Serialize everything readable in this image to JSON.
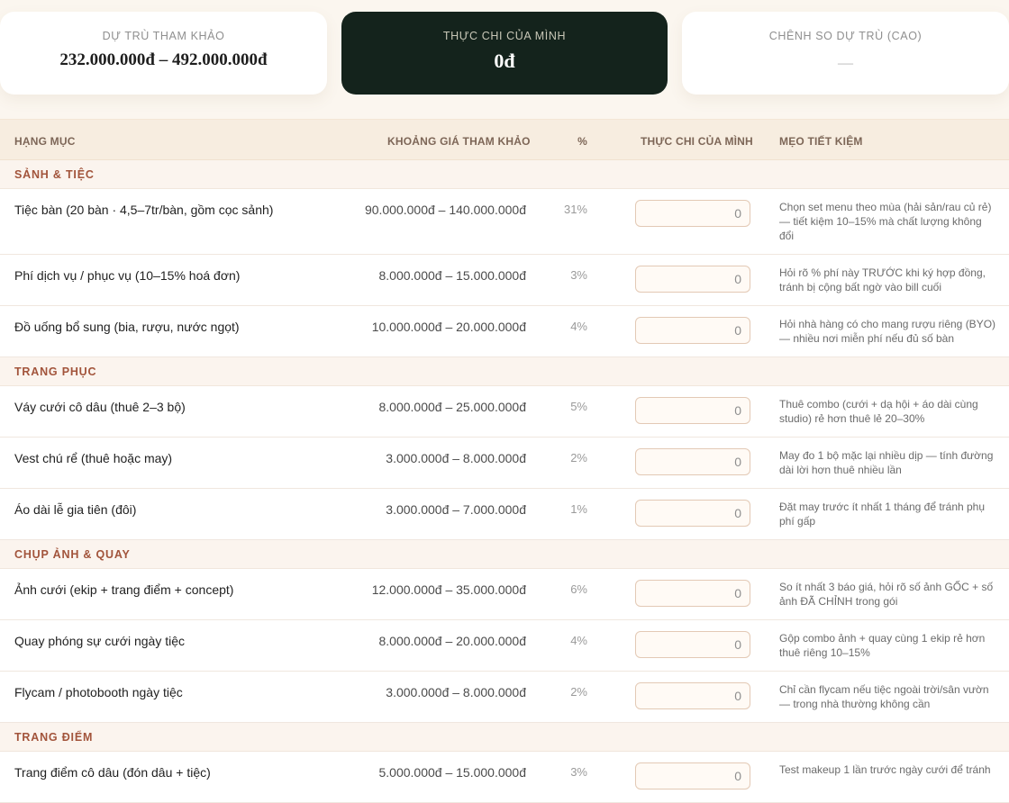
{
  "summary": {
    "reference_label": "DỰ TRÙ THAM KHẢO",
    "reference_value": "232.000.000đ – 492.000.000đ",
    "actual_label": "THỰC CHI CỦA MÌNH",
    "actual_value": "0đ",
    "diff_label": "CHÊNH SO DỰ TRÙ (CAO)",
    "diff_value": "—"
  },
  "table": {
    "headers": {
      "category": "HẠNG MỤC",
      "range": "KHOẢNG GIÁ THAM KHẢO",
      "percent": "%",
      "actual": "THỰC CHI CỦA MÌNH",
      "tip": "MẸO TIẾT KIỆM"
    },
    "sections": [
      {
        "title": "SẢNH & TIỆC",
        "rows": [
          {
            "name": "Tiệc bàn (20 bàn · 4,5–7tr/bàn, gồm cọc sảnh)",
            "range": "90.000.000đ – 140.000.000đ",
            "percent": "31%",
            "input_value": "0",
            "tip": "Chọn set menu theo mùa (hải sản/rau củ rẻ) — tiết kiệm 10–15% mà chất lượng không đổi"
          },
          {
            "name": "Phí dịch vụ / phục vụ (10–15% hoá đơn)",
            "range": "8.000.000đ – 15.000.000đ",
            "percent": "3%",
            "input_value": "0",
            "tip": "Hỏi rõ % phí này TRƯỚC khi ký hợp đồng, tránh bị cộng bất ngờ vào bill cuối"
          },
          {
            "name": "Đồ uống bổ sung (bia, rượu, nước ngọt)",
            "range": "10.000.000đ – 20.000.000đ",
            "percent": "4%",
            "input_value": "0",
            "tip": "Hỏi nhà hàng có cho mang rượu riêng (BYO) — nhiều nơi miễn phí nếu đủ số bàn"
          }
        ]
      },
      {
        "title": "TRANG PHỤC",
        "rows": [
          {
            "name": "Váy cưới cô dâu (thuê 2–3 bộ)",
            "range": "8.000.000đ – 25.000.000đ",
            "percent": "5%",
            "input_value": "0",
            "tip": "Thuê combo (cưới + dạ hội + áo dài cùng studio) rẻ hơn thuê lẻ 20–30%"
          },
          {
            "name": "Vest chú rể (thuê hoặc may)",
            "range": "3.000.000đ – 8.000.000đ",
            "percent": "2%",
            "input_value": "0",
            "tip": "May đo 1 bộ mặc lại nhiều dịp — tính đường dài lời hơn thuê nhiều lần"
          },
          {
            "name": "Áo dài lễ gia tiên (đôi)",
            "range": "3.000.000đ – 7.000.000đ",
            "percent": "1%",
            "input_value": "0",
            "tip": "Đặt may trước ít nhất 1 tháng để tránh phụ phí gấp"
          }
        ]
      },
      {
        "title": "CHỤP ẢNH & QUAY",
        "rows": [
          {
            "name": "Ảnh cưới (ekip + trang điểm + concept)",
            "range": "12.000.000đ – 35.000.000đ",
            "percent": "6%",
            "input_value": "0",
            "tip": "So ít nhất 3 báo giá, hỏi rõ số ảnh GỐC + số ảnh ĐÃ CHỈNH trong gói"
          },
          {
            "name": "Quay phóng sự cưới ngày tiệc",
            "range": "8.000.000đ – 20.000.000đ",
            "percent": "4%",
            "input_value": "0",
            "tip": "Gộp combo ảnh + quay cùng 1 ekip rẻ hơn thuê riêng 10–15%"
          },
          {
            "name": "Flycam / photobooth ngày tiệc",
            "range": "3.000.000đ – 8.000.000đ",
            "percent": "2%",
            "input_value": "0",
            "tip": "Chỉ cần flycam nếu tiệc ngoài trời/sân vườn — trong nhà thường không cần"
          }
        ]
      },
      {
        "title": "TRANG ĐIỂM",
        "rows": [
          {
            "name": "Trang điểm cô dâu (đón dâu + tiệc)",
            "range": "5.000.000đ – 15.000.000đ",
            "percent": "3%",
            "input_value": "0",
            "tip": "Test makeup 1 lần trước ngày cưới để tránh"
          }
        ]
      }
    ]
  }
}
